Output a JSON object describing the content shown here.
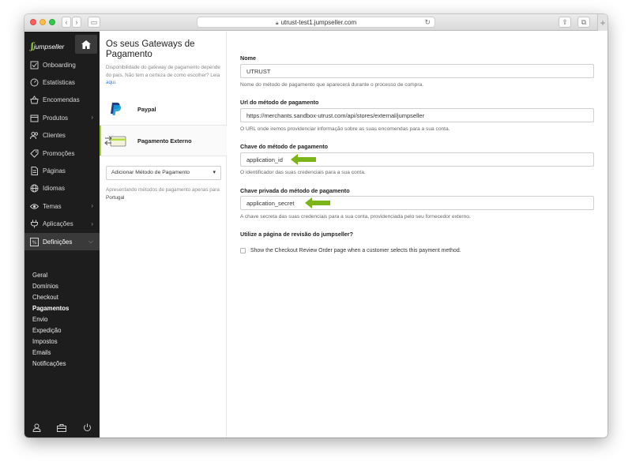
{
  "browser": {
    "url": "utrust-test1.jumpseller.com"
  },
  "brand": {
    "logo_text": "jumpseller"
  },
  "sidebar": {
    "items": [
      {
        "label": "Onboarding",
        "icon": "checkbox-icon"
      },
      {
        "label": "Estatísticas",
        "icon": "gauge-icon"
      },
      {
        "label": "Encomendas",
        "icon": "basket-icon"
      },
      {
        "label": "Produtos",
        "icon": "box-icon",
        "chevron": true
      },
      {
        "label": "Clientes",
        "icon": "users-icon"
      },
      {
        "label": "Promoções",
        "icon": "tag-icon"
      },
      {
        "label": "Páginas",
        "icon": "page-icon"
      },
      {
        "label": "Idiomas",
        "icon": "globe-icon"
      },
      {
        "label": "Temas",
        "icon": "eye-icon",
        "chevron": true
      },
      {
        "label": "Aplicações",
        "icon": "plug-icon",
        "chevron": true
      },
      {
        "label": "Definições",
        "icon": "settings-icon",
        "chevron": true,
        "active": true
      }
    ],
    "submenu": [
      {
        "label": "Geral"
      },
      {
        "label": "Domínios"
      },
      {
        "label": "Checkout"
      },
      {
        "label": "Pagamentos",
        "current": true
      },
      {
        "label": "Envio"
      },
      {
        "label": "Expedição"
      },
      {
        "label": "Impostos"
      },
      {
        "label": "Emails"
      },
      {
        "label": "Notificações"
      }
    ]
  },
  "gateways": {
    "title": "Os seus Gateways de Pagamento",
    "description": "Disponibilidade do gateway de pagamento depende do país. Não tem a certeza de como escolher? Leia",
    "description_link": "aqui.",
    "items": [
      {
        "name": "Paypal"
      },
      {
        "name": "Pagamento Externo",
        "selected": true
      }
    ],
    "add_select": "Adicionar Método de Pagamento",
    "presenting_prefix": "Apresentando métodos de pagamento apenas para",
    "presenting_country": "Portugal"
  },
  "form": {
    "name": {
      "label": "Nome",
      "value": "UTRUST",
      "help": "Nome do método de pagamento que aparecerá durante o processo de compra."
    },
    "url": {
      "label": "Url do método de pagamento",
      "value": "https://merchants.sandbox-utrust.com/api/stores/external/jumpseller",
      "help": "O URL onde iremos providenciar informação sobre as suas encomendas para a sua conta."
    },
    "key": {
      "label": "Chave do método de pagamento",
      "value": "application_id",
      "help": "O identificador das suas credenciais para a sua conta."
    },
    "secret": {
      "label": "Chave privada do método de pagamento",
      "value": "application_secret",
      "help": "A chave secreta das suas credenciais para a sua conta, providenciada pelo seu fornecedor externo."
    },
    "review": {
      "label": "Utilize a página de revisão do jumpseller?",
      "checkbox_label": "Show the Checkout Review Order page when a customer selects this payment method.",
      "checked": false
    }
  },
  "colors": {
    "accent": "#9bd72b",
    "sidebar_bg": "#1d1d1d",
    "arrow": "#7cb518"
  }
}
